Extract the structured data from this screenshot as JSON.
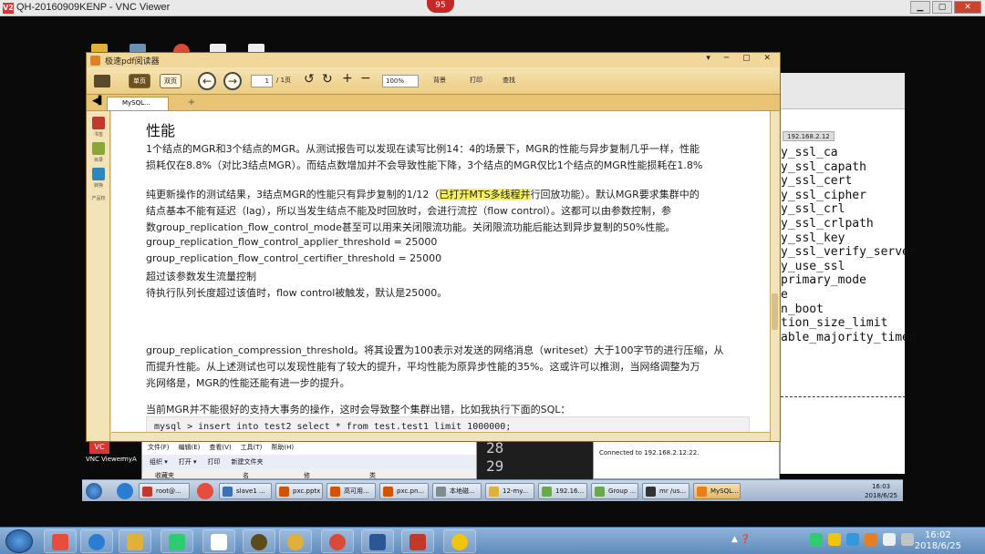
{
  "vnc": {
    "title": "QH-20160909KENP - VNC Viewer",
    "badge": "95",
    "icon_label": "VNC Viewer",
    "icon_label2": "myA"
  },
  "pdf_reader": {
    "title": "极速pdf阅读器",
    "view_single": "单页",
    "view_double": "双页",
    "page_current": "1",
    "page_total": "/ 1页",
    "zoom": "100%",
    "bg_label": "背景",
    "print_label": "打印",
    "find_label": "查找",
    "tab_label": "MySQL...",
    "sidebar": [
      "书签",
      "目录",
      "转换",
      "产品权"
    ]
  },
  "page": {
    "heading": "性能",
    "p1_l1": "1个结点的MGR和3个结点的MGR。从测试报告可以发现在读写比例14：4的场景下，MGR的性能与异步复制几乎一样，性能",
    "p1_l2": "损耗仅在8.8%（对比3结点MGR）。而结点数增加并不会导致性能下降，3个结点的MGR仅比1个结点的MGR性能损耗在1.8%",
    "p2_l1a": "纯更新操作的测试结果，3结点MGR的性能只有异步复制的1/12（",
    "p2_l1b": "已打开MTS多线程并",
    "p2_l1c": "行回放功能）。默认MGR要求集群中的",
    "p2_l2": "结点基本不能有延迟（lag），所以当发生结点不能及时回放时，会进行流控（flow control）。这都可以由参数控制，参",
    "p2_l3": "数group_replication_flow_control_mode甚至可以用来关闭限流功能。关闭限流功能后能达到异步复制的50%性能。",
    "p2_l4": "group_replication_flow_control_applier_threshold = 25000",
    "p2_l5": "group_replication_flow_control_certifier_threshold = 25000",
    "p2_l6": "超过该参数发生流量控制",
    "p2_l7": "待执行队列长度超过该值时，flow control被触发，默认是25000。",
    "p3_l1": "group_replication_compression_threshold。将其设置为100表示对发送的网络消息（writeset）大于100字节的进行压缩，从",
    "p3_l2": "而提升性能。从上述测试也可以发现性能有了较大的提升，平均性能为原异步性能的35%。这或许可以推测，当网络调整为万",
    "p3_l3": "兆网络是，MGR的性能还能有进一步的提升。",
    "p4_l1": "当前MGR并不能很好的支持大事务的操作，这时会导致整个集群出错，比如我执行下面的SQL：",
    "code": "mysql > insert into test2 select * from test.test1 limit 1000000;"
  },
  "terminal": {
    "tab": "192.168.2.12",
    "lines": [
      "y_ssl_ca",
      "y_ssl_capath",
      "y_ssl_cert",
      "y_ssl_cipher",
      "y_ssl_crl",
      "y_ssl_crlpath",
      "y_ssl_key",
      "y_ssl_verify_server",
      "y_use_ssl",
      "primary_mode",
      "e",
      "n_boot",
      "tion_size_limit",
      "able_majority_timed"
    ]
  },
  "explorer": {
    "menu": [
      "文件(F)",
      "编辑(E)",
      "查看(V)",
      "工具(T)",
      "帮助(H)"
    ],
    "tools": [
      "组织 ▾",
      "打开 ▾",
      "打印",
      "新建文件夹"
    ],
    "cols": [
      "名称",
      "修改日期",
      "类型"
    ],
    "fav": "收藏夹"
  },
  "black_pane": [
    "28",
    "29"
  ],
  "connection": "Connected to 192.168.2.12:22.",
  "inner_taskbar": {
    "items": [
      "root@...",
      "slave1 ...",
      "pxc.pptx",
      "高可用...",
      "pxc.pn...",
      "本地磁...",
      "12-my...",
      "192.16...",
      "Group ...",
      "mr /us...",
      "MySQL..."
    ],
    "time": "16:03",
    "date": "2018/6/25"
  },
  "outer_taskbar": {
    "time": "16:02",
    "date": "2018/6/25"
  }
}
